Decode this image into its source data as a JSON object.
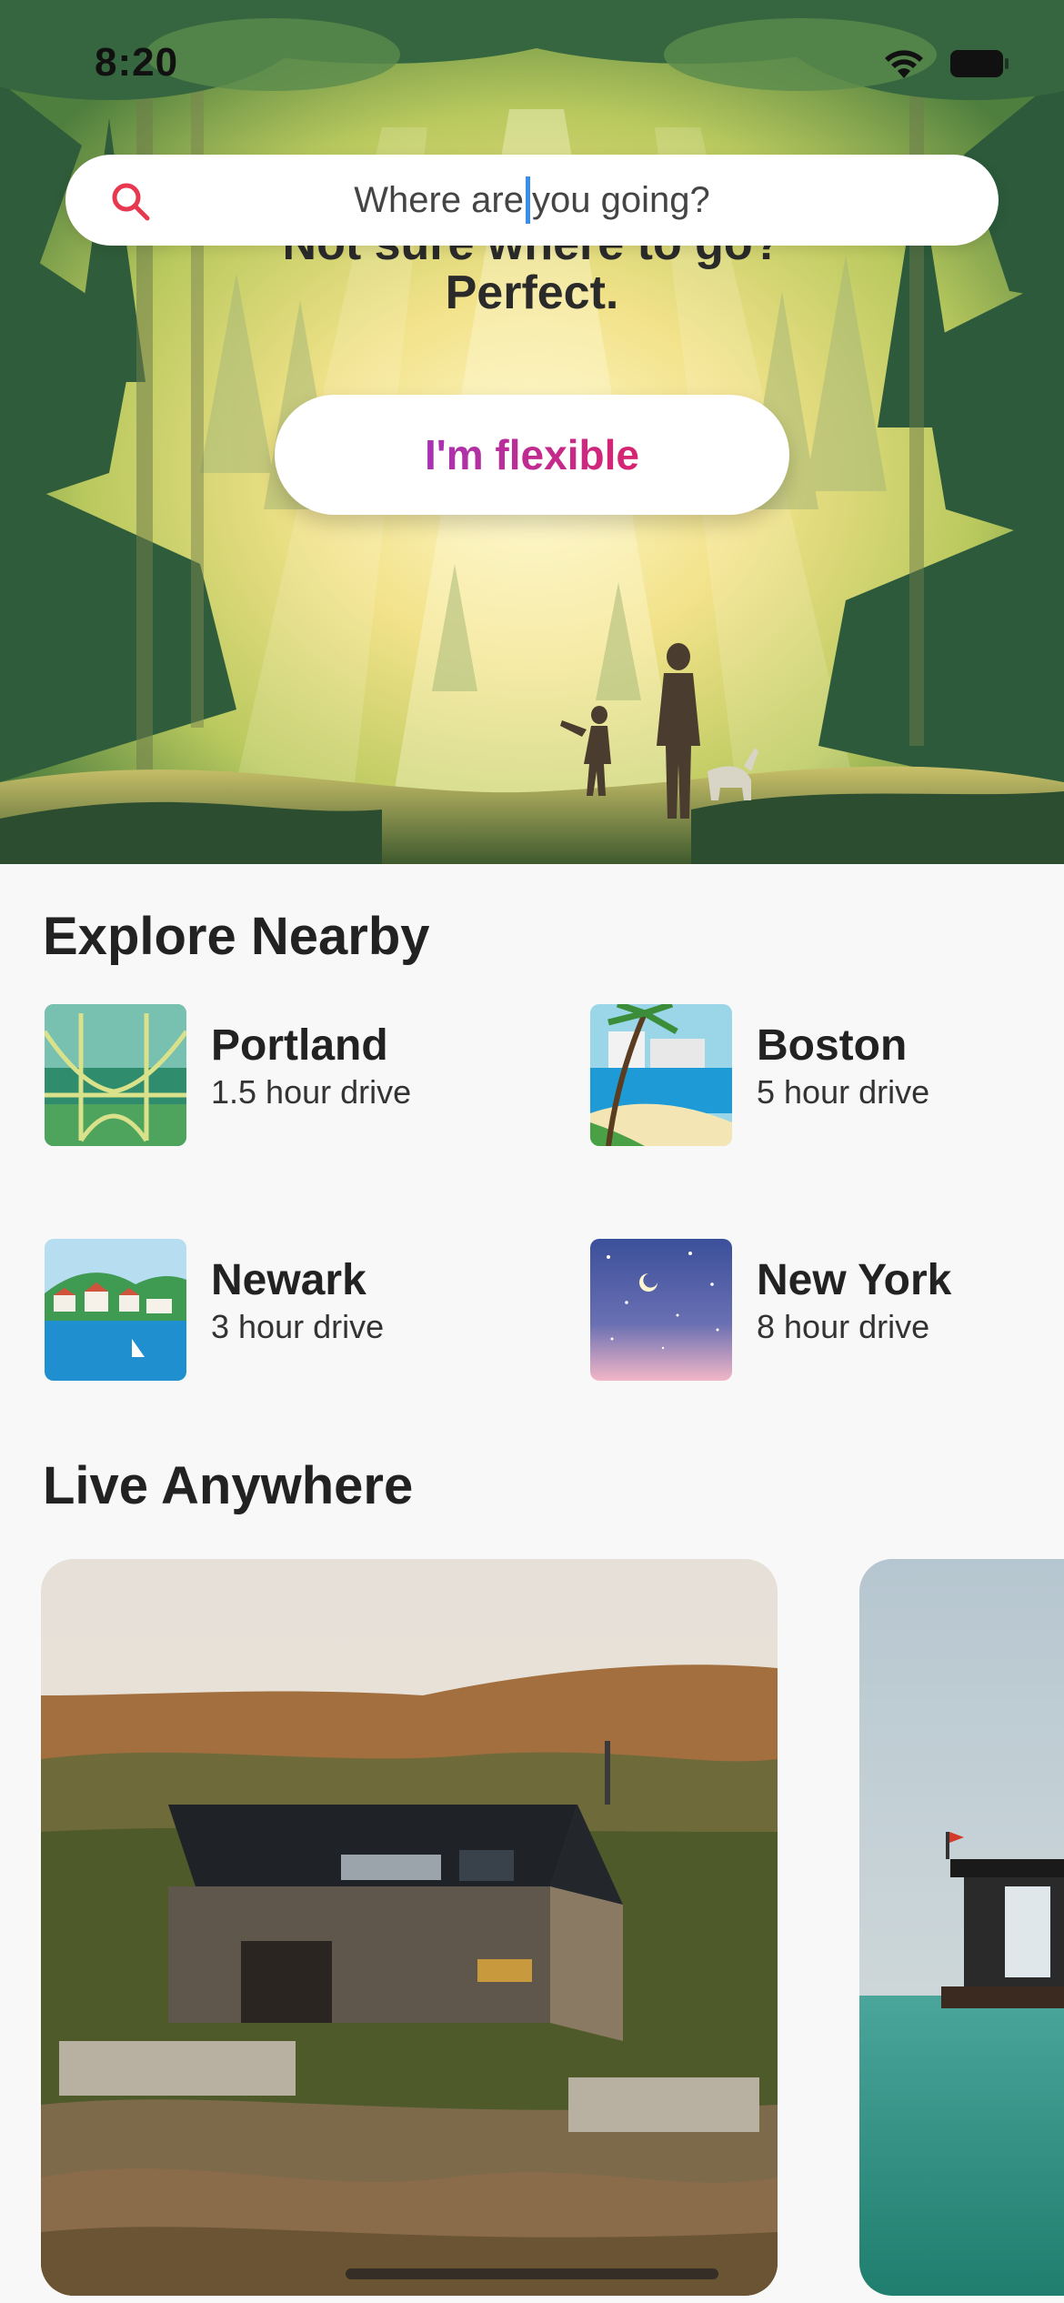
{
  "status": {
    "time": "8:20"
  },
  "search": {
    "text_before_caret": "Where are",
    "text_after_caret": "you going?"
  },
  "hero": {
    "line1": "Not sure where to go?",
    "line2": "Perfect.",
    "flexible_button": "I'm flexible"
  },
  "explore": {
    "title": "Explore Nearby",
    "places": [
      {
        "name": "Portland",
        "drive": "1.5 hour drive",
        "icon": "bridge-illustration"
      },
      {
        "name": "Boston",
        "drive": "5 hour drive",
        "icon": "beach-illustration"
      },
      {
        "name": "Newark",
        "drive": "3 hour drive",
        "icon": "harbor-illustration"
      },
      {
        "name": "New York",
        "drive": "8 hour drive",
        "icon": "night-sky-illustration"
      }
    ]
  },
  "live": {
    "title": "Live Anywhere"
  },
  "colors": {
    "brand_gradient_start": "#a733b3",
    "brand_gradient_end": "#d8246f",
    "search_icon": "#e8384f",
    "background": "#f8f8f8"
  }
}
